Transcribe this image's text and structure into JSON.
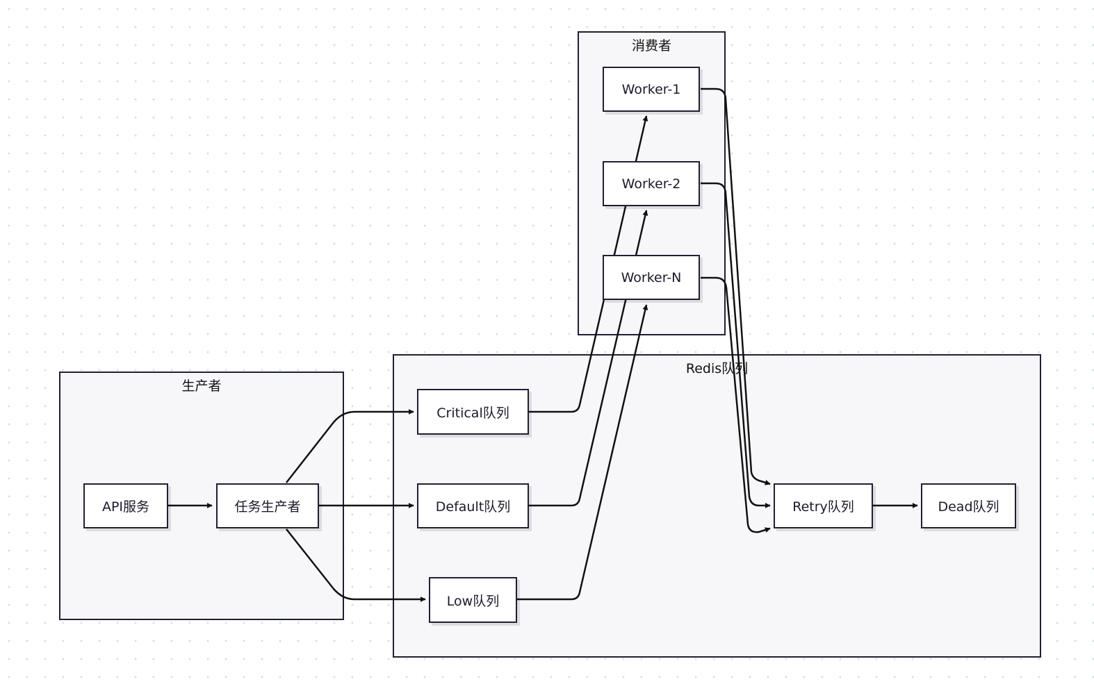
{
  "groups": {
    "consumer": "消费者",
    "redis": "Redis队列",
    "producer": "生产者"
  },
  "nodes": {
    "worker1": "Worker-1",
    "worker2": "Worker-2",
    "workerN": "Worker-N",
    "api": "API服务",
    "taskProducer": "任务生产者",
    "critical": "Critical队列",
    "default": "Default队列",
    "low": "Low队列",
    "retry": "Retry队列",
    "dead": "Dead队列"
  },
  "colors": {
    "stroke": "#1f1f33",
    "group_fill": "#f7f7fa",
    "node_fill": "#ffffff"
  }
}
